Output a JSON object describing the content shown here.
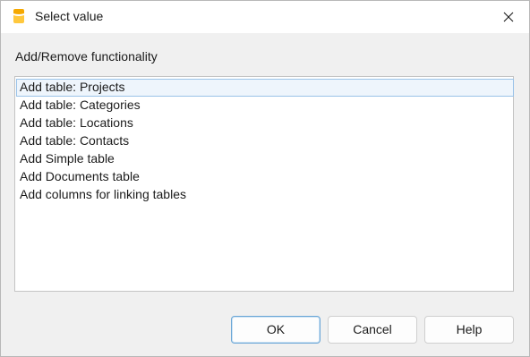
{
  "window": {
    "title": "Select value",
    "app_icon": "banana-accounting-icon",
    "close_icon": "close-icon"
  },
  "section": {
    "label": "Add/Remove functionality"
  },
  "list": {
    "selected_index": 0,
    "items": [
      "Add table: Projects",
      "Add table: Categories",
      "Add table: Locations",
      "Add table: Contacts",
      "Add Simple table",
      "Add Documents table",
      "Add columns for linking tables"
    ]
  },
  "buttons": {
    "ok": "OK",
    "cancel": "Cancel",
    "help": "Help"
  },
  "colors": {
    "accent": "#f7b500",
    "selection_border": "#9bc3e8",
    "selection_fill": "#eef5fc"
  }
}
